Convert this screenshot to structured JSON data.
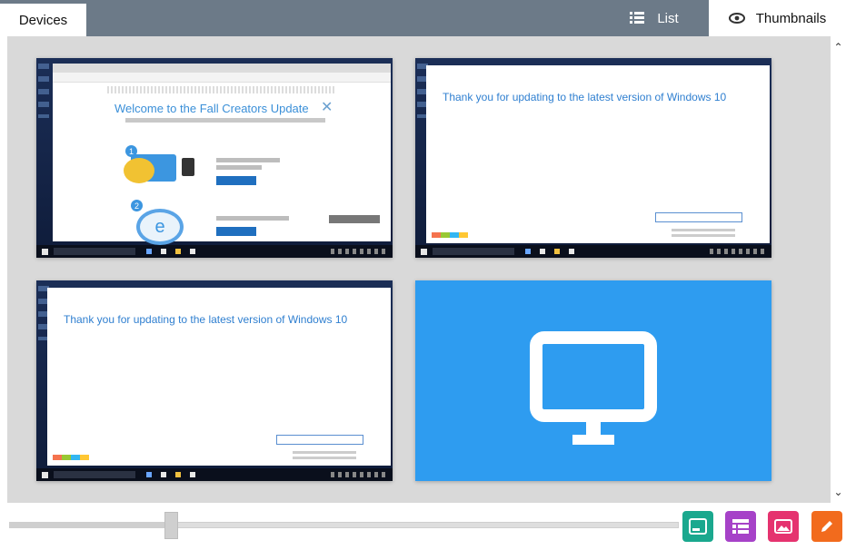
{
  "header": {
    "tab_devices": "Devices",
    "view_list_label": "List",
    "view_thumbnails_label": "Thumbnails"
  },
  "thumbnails": [
    {
      "title": "Welcome to the Fall Creators Update",
      "step1": "1",
      "step2": "2",
      "step2_glyph": "e"
    },
    {
      "title": "Thank you for updating to the latest version of Windows 10"
    },
    {
      "title": "Thank you for updating to the latest version of Windows 10"
    },
    {
      "icon": "monitor-icon"
    }
  ],
  "zoom_slider": {
    "value_fraction": 0.24
  },
  "toolbar": {
    "buttons": [
      {
        "icon": "screen-icon",
        "color": "#1aa88e"
      },
      {
        "icon": "list-view-icon",
        "color": "#a642c8"
      },
      {
        "icon": "image-icon",
        "color": "#e5336f"
      },
      {
        "icon": "pencil-icon",
        "color": "#f26b1d"
      }
    ]
  },
  "colors": {
    "header_bg": "#6c7a88",
    "content_bg": "#d9d9d9",
    "offline_tile": "#2e9cf0"
  }
}
